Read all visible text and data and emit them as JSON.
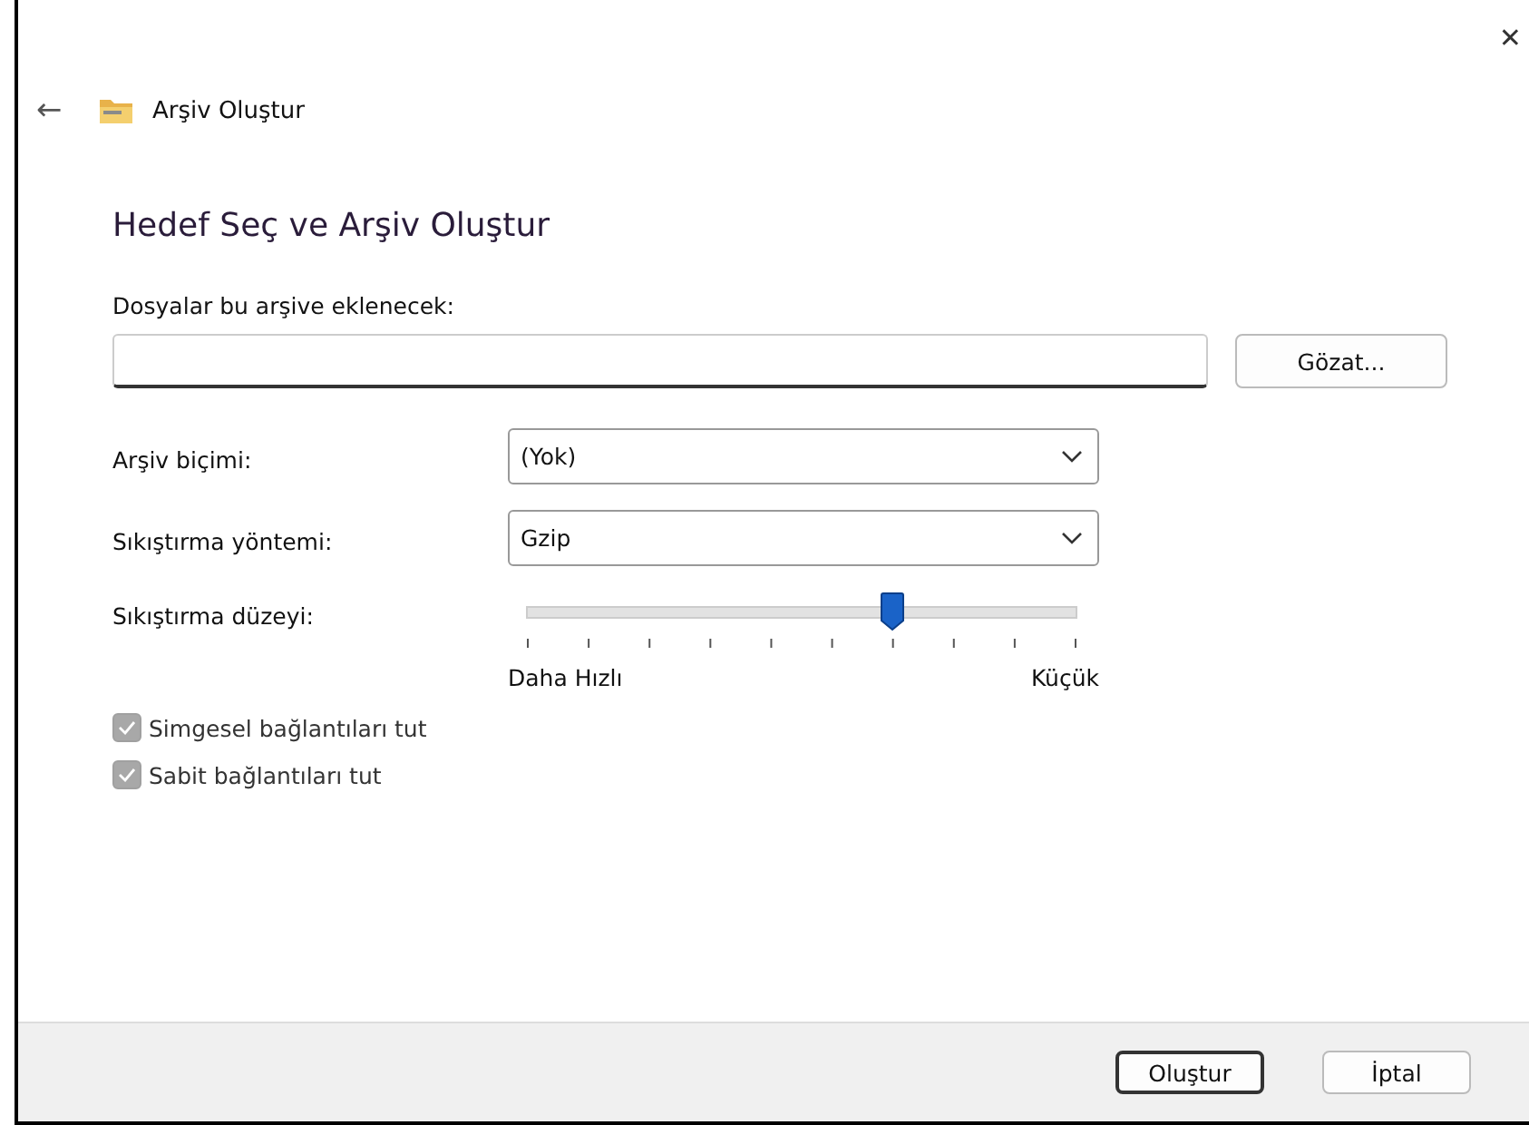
{
  "window": {
    "title": "Arşiv Oluştur",
    "close": "✕",
    "back": "←"
  },
  "heading": "Hedef Seç ve Arşiv Oluştur",
  "files": {
    "label": "Dosyalar bu arşive eklenecek:",
    "browse": "Gözat..."
  },
  "selects": [
    {
      "label": "Arşiv biçimi:",
      "value": "(Yok)"
    },
    {
      "label": "Sıkıştırma yöntemi:",
      "value": "Gzip"
    }
  ],
  "slider": {
    "label": "Sıkıştırma düzeyi:",
    "level": 0.667,
    "min_label": "Daha Hızlı",
    "max_label": "Küçük"
  },
  "checkboxes": [
    {
      "label": "Simgesel bağlantıları tut",
      "checked": true,
      "disabled": true
    },
    {
      "label": "Sabit bağlantıları tut",
      "checked": true,
      "disabled": true
    }
  ],
  "buttons": [
    {
      "label": "Oluştur",
      "default": true
    },
    {
      "label": "İptal",
      "default": false
    }
  ]
}
